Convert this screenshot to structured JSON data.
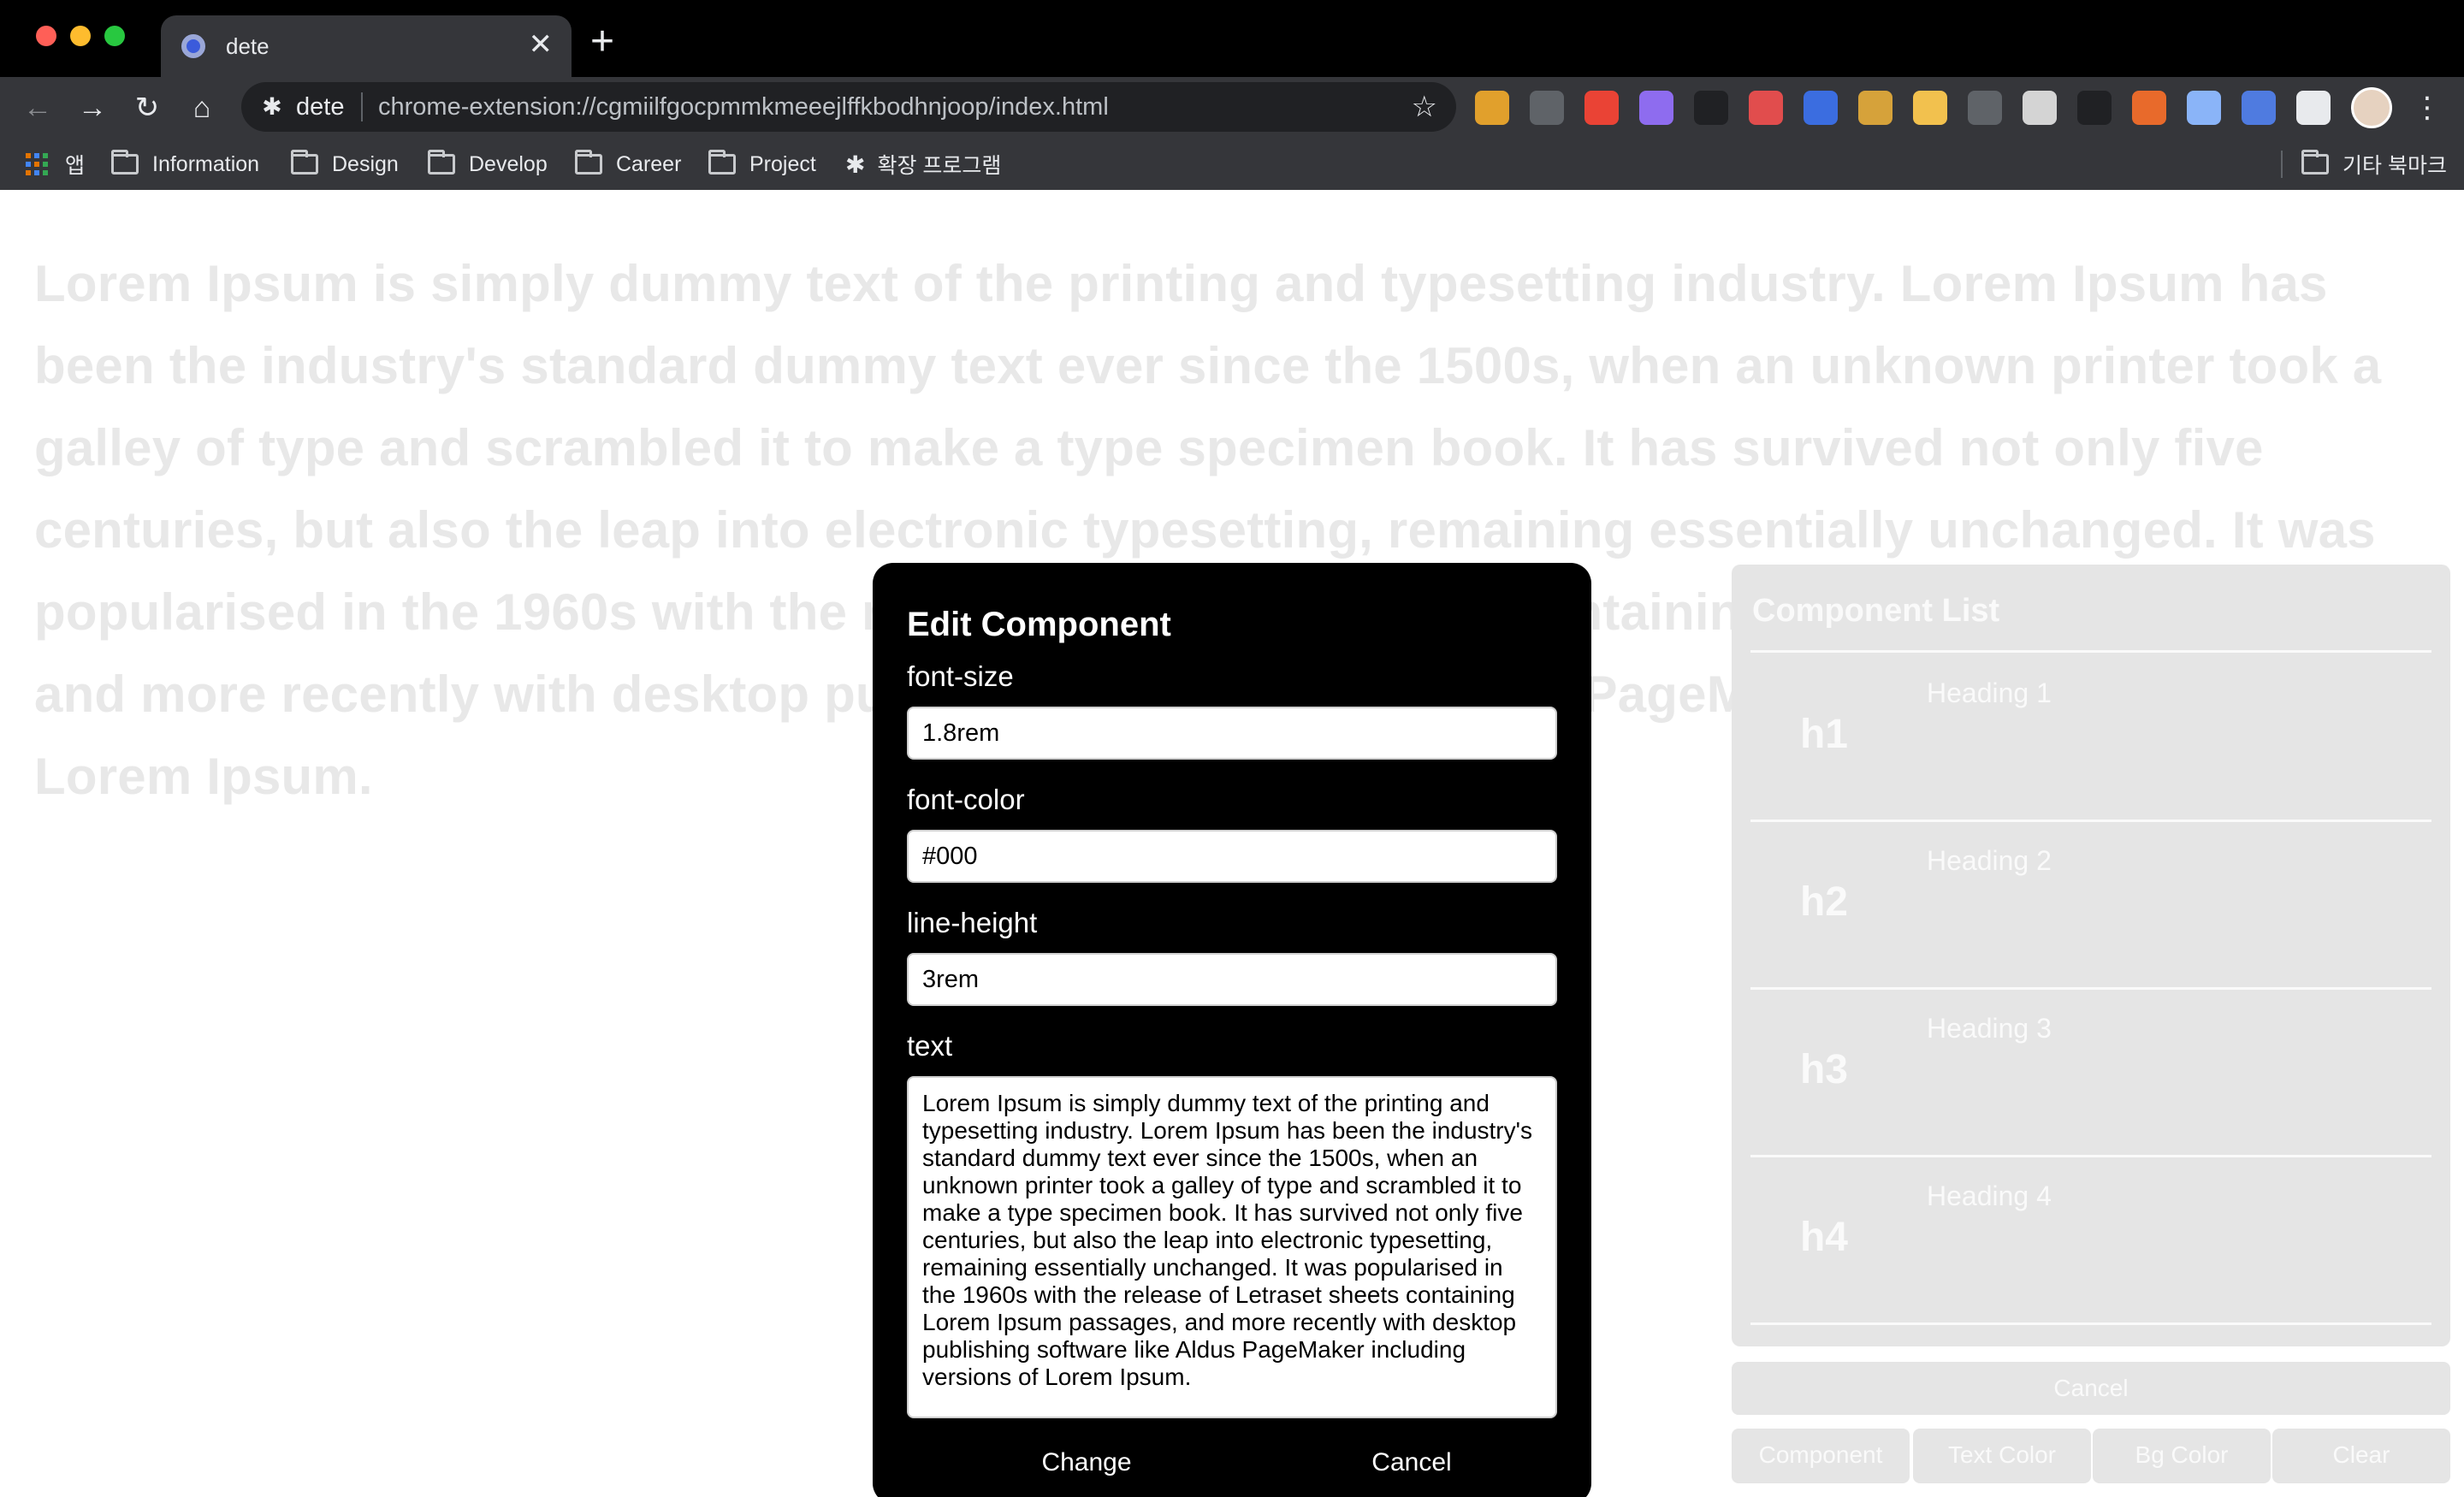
{
  "browser": {
    "tab": {
      "title": "dete",
      "close_glyph": "✕"
    },
    "new_tab_glyph": "+",
    "nav": {
      "back": "←",
      "forward": "→",
      "reload": "↻",
      "home": "⌂"
    },
    "omnibox": {
      "site_label": "dete",
      "url": "chrome-extension://cgmiilfgocpmmkmeeejlffkbodhnjoop/index.html",
      "star_glyph": "☆",
      "puzzle_glyph": "✱"
    },
    "menu_glyph": "⋮",
    "extension_colors": [
      "#e1a02c",
      "#5f6368",
      "#ea4335",
      "#8e6cef",
      "#202124",
      "#e14d4d",
      "#3b6de0",
      "#d6a23a",
      "#f2c14e",
      "#5f6368",
      "#d4d4d4",
      "#202124",
      "#e86a2b",
      "#8ab4f8",
      "#4f7be0",
      "#e8eaed"
    ],
    "bookmarks": [
      {
        "label": "앱",
        "kind": "apps"
      },
      {
        "label": "Information",
        "kind": "folder"
      },
      {
        "label": "Design",
        "kind": "folder"
      },
      {
        "label": "Develop",
        "kind": "folder"
      },
      {
        "label": "Career",
        "kind": "folder"
      },
      {
        "label": "Project",
        "kind": "folder"
      },
      {
        "label": "확장 프로그램",
        "kind": "extension"
      }
    ],
    "other_bookmarks": "기타 북마크"
  },
  "page": {
    "background_text": "Lorem Ipsum is simply dummy text of the printing and typesetting industry. Lorem Ipsum has been the industry's standard dummy text ever since the 1500s, when an unknown printer took a galley of type and scrambled it to make a type specimen book. It has survived not only five centuries, but also the leap into electronic typesetting, remaining essentially unchanged. It was popularised in the 1960s with the release of Letraset sheets containing Lorem Ipsum passages, and more recently with desktop publishing software like Aldus PageMaker including versions of Lorem Ipsum."
  },
  "component_list": {
    "title": "Component List",
    "items": [
      {
        "tag": "h1",
        "label": "Heading 1"
      },
      {
        "tag": "h2",
        "label": "Heading 2"
      },
      {
        "tag": "h3",
        "label": "Heading 3"
      },
      {
        "tag": "h4",
        "label": "Heading 4"
      }
    ],
    "cancel_label": "Cancel",
    "toolbar": [
      "Component",
      "Text Color",
      "Bg Color",
      "Clear"
    ]
  },
  "modal": {
    "title": "Edit Component",
    "fields": {
      "font_size": {
        "label": "font-size",
        "value": "1.8rem"
      },
      "font_color": {
        "label": "font-color",
        "value": "#000"
      },
      "line_height": {
        "label": "line-height",
        "value": "3rem"
      },
      "text": {
        "label": "text",
        "value": "Lorem Ipsum is simply dummy text of the printing and typesetting industry. Lorem Ipsum has been the industry's standard dummy text ever since the 1500s, when an unknown printer took a galley of type and scrambled it to make a type specimen book. It has survived not only five centuries, but also the leap into electronic typesetting, remaining essentially unchanged. It was popularised in the 1960s with the release of Letraset sheets containing Lorem Ipsum passages, and more recently with desktop publishing software like Aldus PageMaker including versions of Lorem Ipsum."
      }
    },
    "change_label": "Change",
    "cancel_label": "Cancel"
  }
}
